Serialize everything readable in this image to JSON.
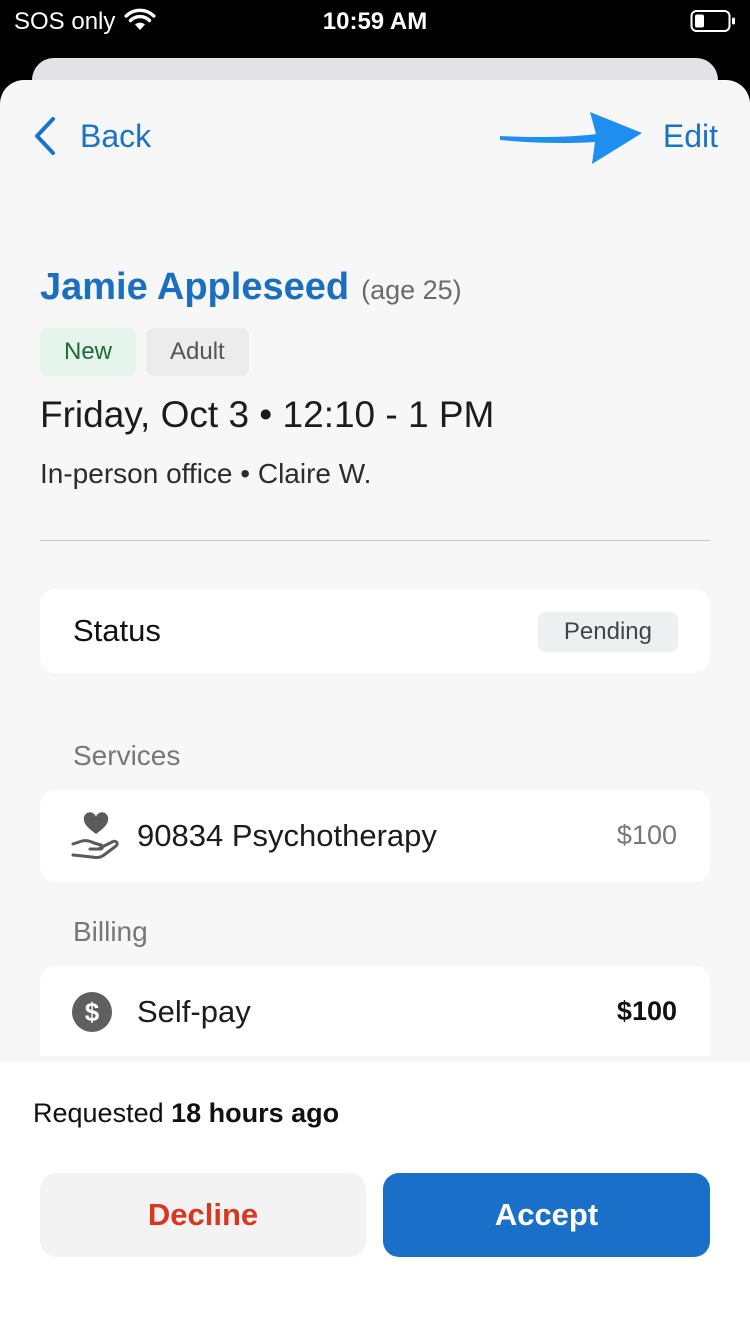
{
  "status_bar": {
    "carrier": "SOS only",
    "time": "10:59 AM",
    "icons": [
      "wifi-icon",
      "battery-icon"
    ]
  },
  "nav": {
    "back_label": "Back",
    "edit_label": "Edit"
  },
  "client": {
    "name": "Jamie Appleseed",
    "age": "(age 25)",
    "tags": [
      "New",
      "Adult"
    ]
  },
  "appointment": {
    "datetime": "Friday, Oct 3 • 12:10 - 1 PM",
    "location": "In-person office • Claire W."
  },
  "status": {
    "label": "Status",
    "value": "Pending"
  },
  "services": {
    "label": "Services",
    "items": [
      {
        "icon": "hand-heart-icon",
        "name": "90834 Psychotherapy",
        "price": "$100"
      }
    ]
  },
  "billing": {
    "label": "Billing",
    "items": [
      {
        "icon": "dollar-circle-icon",
        "name": "Self-pay",
        "amount": "$100"
      }
    ]
  },
  "footer": {
    "requested_prefix": "Requested",
    "requested_time": "18 hours ago",
    "decline_label": "Decline",
    "accept_label": "Accept"
  },
  "colors": {
    "accent": "#1a70c8",
    "decline": "#d9381e",
    "new_tag_bg": "#e4f4ea",
    "arrow": "#1e8ef0"
  }
}
